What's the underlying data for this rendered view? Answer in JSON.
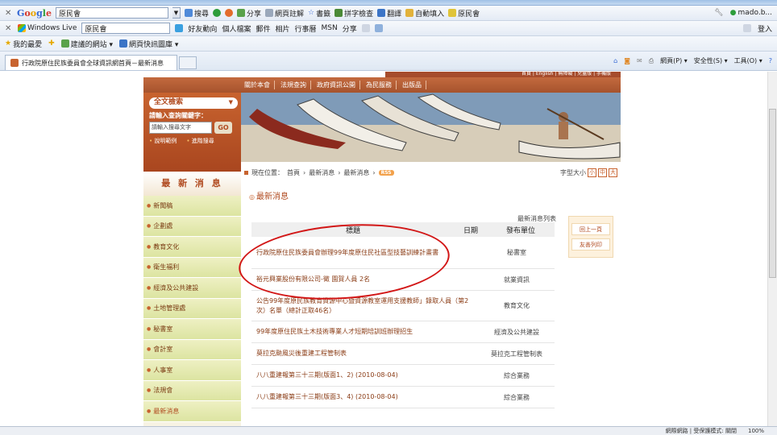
{
  "browser": {
    "toolbar1": {
      "search_value": "原民會",
      "items": [
        "搜尋",
        "分享",
        "網頁註解",
        "書籤",
        "拼字檢查",
        "翻譯",
        "自動填入",
        "原民會"
      ],
      "account": "mado.b..."
    },
    "toolbar2": {
      "brand": "Windows Live",
      "search_value": "原民會",
      "items": [
        "好友動向",
        "個人檔案",
        "郵件",
        "相片",
        "行事曆",
        "MSN",
        "分享"
      ],
      "signin": "登入"
    },
    "favorites_bar": {
      "favorites": "我的最愛",
      "items": [
        "建議的網站 ▾",
        "網頁快訊圖庫 ▾"
      ]
    },
    "tab": {
      "title": "行政院原住民族委員會全球資訊網首頁－最新消息"
    },
    "commands": [
      "網頁(P) ▾",
      "安全性(S) ▾",
      "工具(O) ▾"
    ],
    "status": {
      "zone": "網際網路 | 受保護模式: 關閉",
      "zoom": "100%"
    }
  },
  "site": {
    "util_nav": "首頁 | English | 無障礙 | 兒童版 | 手機版",
    "topnav": [
      "關於本會",
      "法規查詢",
      "政府資訊公開",
      "為民服務",
      "出版品"
    ],
    "search": {
      "select_label": "全文檢索",
      "prompt": "請輸入查詢關鍵字：",
      "placeholder": "請輸入搜尋文字",
      "go": "GO",
      "help": "說明範例",
      "advanced": "進階搜尋"
    },
    "latest_heading": "最 新 消 息",
    "sidebar": [
      "新聞稿",
      "企劃處",
      "教育文化",
      "衛生福利",
      "經濟及公共建設",
      "土地管理處",
      "秘書室",
      "會計室",
      "人事室",
      "法規會",
      "最新消息"
    ],
    "breadcrumb": {
      "label": "現在位置：",
      "items": [
        "首頁",
        "最新消息",
        "最新消息"
      ],
      "rss": "RSS"
    },
    "font_size": {
      "label": "字型大小",
      "options": [
        "小",
        "中",
        "大"
      ]
    },
    "section_title": "最新消息",
    "list_caption": "最新消息列表",
    "table": {
      "headers": [
        "標題",
        "日期",
        "發布單位"
      ],
      "rows": [
        {
          "title": "行政院原住民族委員會辦理99年度原住民社區型技藝訓練計畫書",
          "unit": "秘書室"
        },
        {
          "title": "裕元興業股份有限公司-徵 園賀人員 2名",
          "unit": "就業資訊"
        },
        {
          "title": "公告99年度原民族教育資源中心暨資源教室運用支援教師」錄取人員（第2次）名單（總計正取46名）",
          "unit": "教育文化"
        },
        {
          "title": "99年度原住民族土木技術專業人才短期培訓班辦理招生",
          "unit": "經濟及公共建設"
        },
        {
          "title": "莫拉克颱風災後重建工程管制表",
          "unit": "莫拉克工程管制表"
        },
        {
          "title": "八八重建報第三十三期(版面1、2) (2010-08-04)",
          "unit": "綜合業務"
        },
        {
          "title": "八八重建報第三十三期(版面3、4) (2010-08-04)",
          "unit": "綜合業務"
        }
      ]
    },
    "side_buttons": [
      "回上一頁",
      "友善列印"
    ]
  },
  "colors": {
    "brand": "#b04a1f",
    "menu_bg": "#dce4a1",
    "annotation": "#d21616"
  }
}
